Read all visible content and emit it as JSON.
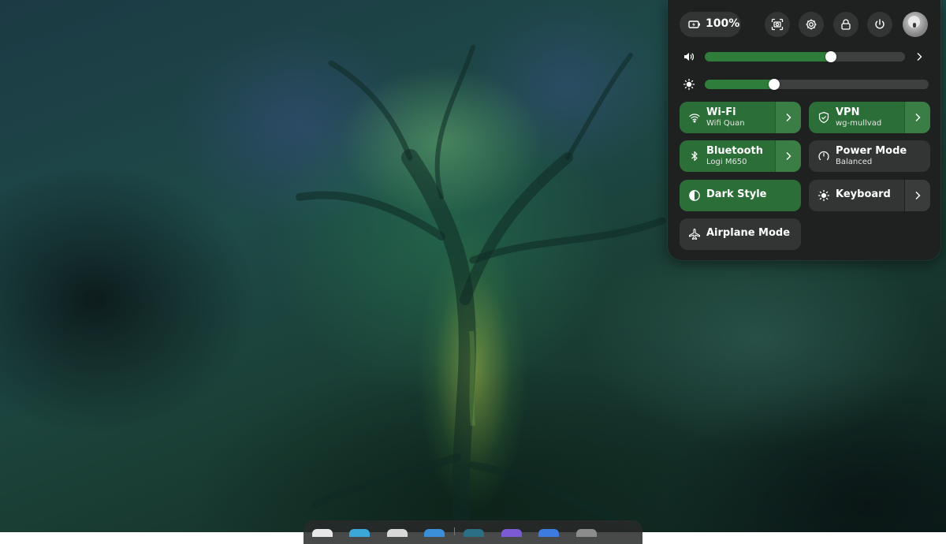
{
  "battery": {
    "level": "100%",
    "icon": "battery-charging-icon"
  },
  "header_actions": [
    {
      "name": "screenshot-button",
      "icon": "screenshot-icon"
    },
    {
      "name": "settings-button",
      "icon": "gear-icon"
    },
    {
      "name": "lock-button",
      "icon": "lock-icon"
    },
    {
      "name": "power-button",
      "icon": "power-icon"
    }
  ],
  "volume": {
    "level": 0.63,
    "icon": "speaker-icon"
  },
  "brightness": {
    "level": 0.31,
    "icon": "sun-icon"
  },
  "tiles": {
    "wifi": {
      "title": "Wi-Fi",
      "subtitle": "Wifi Quan",
      "active": true
    },
    "vpn": {
      "title": "VPN",
      "subtitle": "wg-mullvad",
      "active": true
    },
    "bluetooth": {
      "title": "Bluetooth",
      "subtitle": "Logi M650",
      "active": true
    },
    "power_mode": {
      "title": "Power Mode",
      "subtitle": "Balanced",
      "active": false
    },
    "dark_style": {
      "title": "Dark Style",
      "active": true
    },
    "keyboard": {
      "title": "Keyboard",
      "active": false
    },
    "airplane": {
      "title": "Airplane Mode",
      "active": false
    }
  },
  "colors": {
    "accent": "#2b6e37",
    "panel": "#1f2020",
    "tile_off": "#333535"
  },
  "dock": {
    "apps": [
      {
        "name": "dock-app-files",
        "color": "#e8e8e8"
      },
      {
        "name": "dock-app-browser",
        "color": "#3aa7d9"
      },
      {
        "name": "dock-app-editor",
        "color": "#d8d8d8"
      },
      {
        "name": "dock-app-store",
        "color": "#3b8fd9"
      },
      {
        "name": "dock-app-terminal",
        "color": "#2a6f83"
      },
      {
        "name": "dock-app-chat",
        "color": "#7c5ad6"
      },
      {
        "name": "dock-app-mail",
        "color": "#3d7be0"
      },
      {
        "name": "dock-app-grid",
        "color": "#8c8c8c"
      }
    ]
  }
}
